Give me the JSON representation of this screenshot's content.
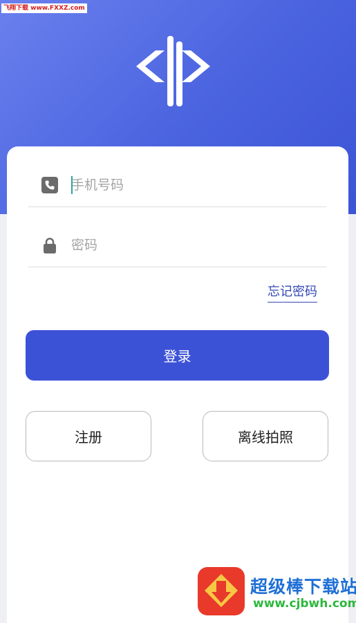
{
  "watermark_top": "飞翔下载 www.FXXZ.com",
  "login_form": {
    "phone_placeholder": "手机号码",
    "password_placeholder": "密码",
    "forgot_password": "忘记密码",
    "login_button": "登录",
    "register_button": "注册",
    "offline_photo_button": "离线拍照"
  },
  "watermark_bottom": {
    "site_name": "超级棒下载站",
    "url": "www.cjbwh.com"
  },
  "colors": {
    "hero_gradient_start": "#6a80ee",
    "hero_gradient_end": "#3c55d6",
    "primary_button": "#3c52d6",
    "link": "#3548b5",
    "page_background": "#eef0f4"
  },
  "icons": {
    "logo": "code-brackets-logo",
    "phone": "phone-icon",
    "password": "lock-icon"
  }
}
